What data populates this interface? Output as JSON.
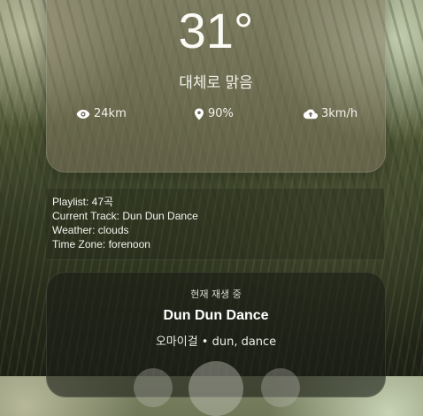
{
  "weather": {
    "temperature": "31°",
    "condition": "대체로 맑음",
    "visibility": "24km",
    "humidity": "90%",
    "wind": "3km/h"
  },
  "info": {
    "playlist": "Playlist: 47곡",
    "current_track": "Current Track: Dun Dun Dance",
    "weather": "Weather: clouds",
    "time_zone": "Time Zone: forenoon"
  },
  "player": {
    "now_playing_label": "현재 재생 중",
    "track_title": "Dun Dun Dance",
    "track_meta": "오마이걸 • dun, dance"
  },
  "icons": {
    "visibility": "eye-icon",
    "humidity": "location-pin-icon",
    "wind": "cloud-upload-icon"
  }
}
